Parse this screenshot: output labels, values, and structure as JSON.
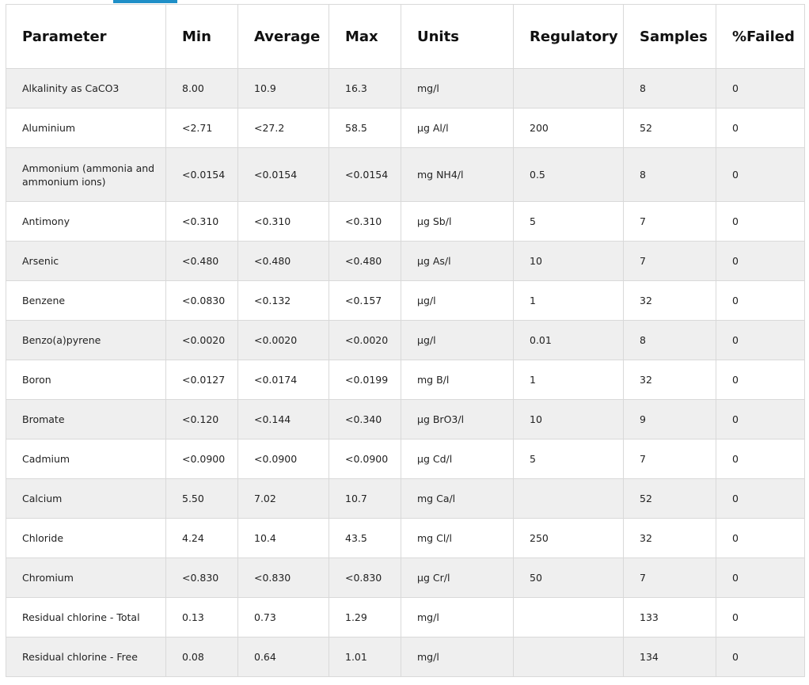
{
  "table": {
    "headers": [
      "Parameter",
      "Min",
      "Average",
      "Max",
      "Units",
      "Regulatory",
      "Samples",
      "%Failed"
    ],
    "rows": [
      [
        "Alkalinity as CaCO3",
        "8.00",
        "10.9",
        "16.3",
        "mg/l",
        "",
        "8",
        "0"
      ],
      [
        "Aluminium",
        "<2.71",
        "<27.2",
        "58.5",
        "µg Al/l",
        "200",
        "52",
        "0"
      ],
      [
        "Ammonium (ammonia and ammonium ions)",
        "<0.0154",
        "<0.0154",
        "<0.0154",
        "mg NH4/l",
        "0.5",
        "8",
        "0"
      ],
      [
        "Antimony",
        "<0.310",
        "<0.310",
        "<0.310",
        "µg Sb/l",
        "5",
        "7",
        "0"
      ],
      [
        "Arsenic",
        "<0.480",
        "<0.480",
        "<0.480",
        "µg As/l",
        "10",
        "7",
        "0"
      ],
      [
        "Benzene",
        "<0.0830",
        "<0.132",
        "<0.157",
        "µg/l",
        "1",
        "32",
        "0"
      ],
      [
        "Benzo(a)pyrene",
        "<0.0020",
        "<0.0020",
        "<0.0020",
        "µg/l",
        "0.01",
        "8",
        "0"
      ],
      [
        "Boron",
        "<0.0127",
        "<0.0174",
        "<0.0199",
        "mg B/l",
        "1",
        "32",
        "0"
      ],
      [
        "Bromate",
        "<0.120",
        "<0.144",
        "<0.340",
        "µg BrO3/l",
        "10",
        "9",
        "0"
      ],
      [
        "Cadmium",
        "<0.0900",
        "<0.0900",
        "<0.0900",
        "µg Cd/l",
        "5",
        "7",
        "0"
      ],
      [
        "Calcium",
        "5.50",
        "7.02",
        "10.7",
        "mg Ca/l",
        "",
        "52",
        "0"
      ],
      [
        "Chloride",
        "4.24",
        "10.4",
        "43.5",
        "mg Cl/l",
        "250",
        "32",
        "0"
      ],
      [
        "Chromium",
        "<0.830",
        "<0.830",
        "<0.830",
        "µg Cr/l",
        "50",
        "7",
        "0"
      ],
      [
        "Residual chlorine - Total",
        "0.13",
        "0.73",
        "1.29",
        "mg/l",
        "",
        "133",
        "0"
      ],
      [
        "Residual chlorine - Free",
        "0.08",
        "0.64",
        "1.01",
        "mg/l",
        "",
        "134",
        "0"
      ]
    ]
  },
  "colors": {
    "accent": "#1f8fc7",
    "row_stripe": "#efefef",
    "border": "#d9d9d9"
  }
}
